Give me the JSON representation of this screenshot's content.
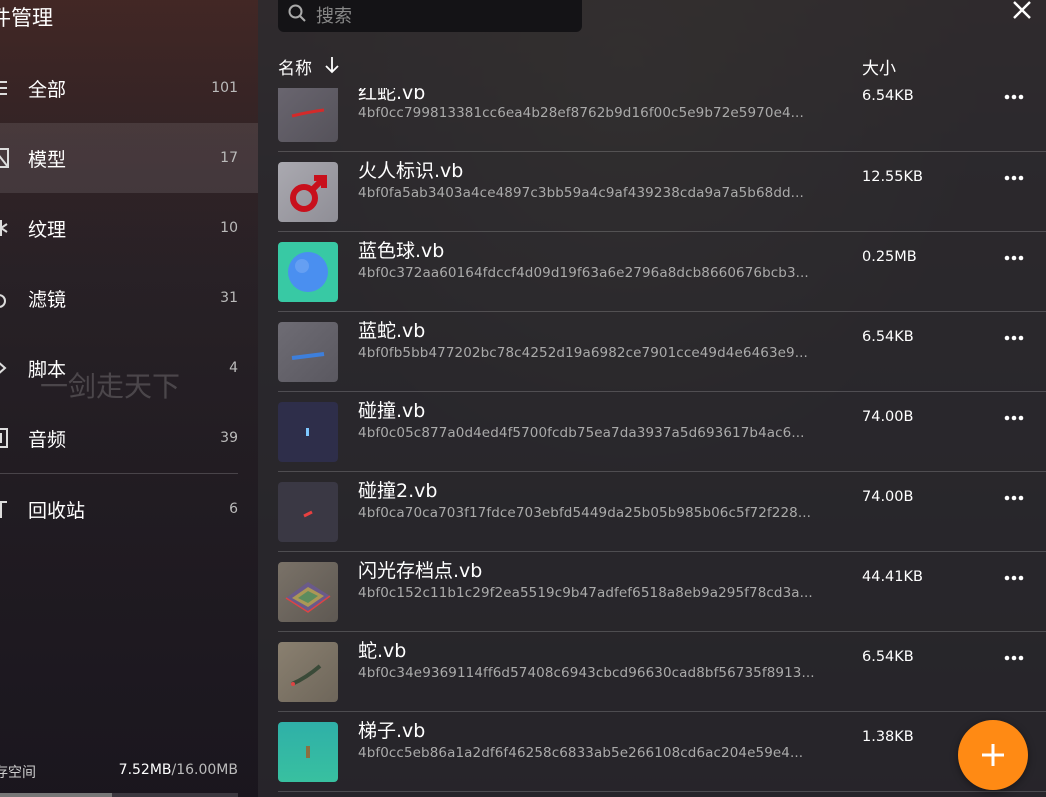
{
  "sidebar": {
    "title": "件管理",
    "items": [
      {
        "label": "全部",
        "count": "101",
        "icon": "layers-icon"
      },
      {
        "label": "模型",
        "count": "17",
        "icon": "cube-icon"
      },
      {
        "label": "纹理",
        "count": "10",
        "icon": "texture-icon"
      },
      {
        "label": "滤镜",
        "count": "31",
        "icon": "filter-icon"
      },
      {
        "label": "脚本",
        "count": "4",
        "icon": "code-icon"
      },
      {
        "label": "音频",
        "count": "39",
        "icon": "audio-icon"
      },
      {
        "label": "回收站",
        "count": "6",
        "icon": "trash-icon"
      }
    ],
    "watermark": "一剑走天下",
    "storage_label": "存空间",
    "storage_used": "7.52MB",
    "storage_total": "/16.00MB",
    "storage_fraction": 0.47
  },
  "main": {
    "search_placeholder": "搜索",
    "col_name": "名称",
    "col_size": "大小",
    "files": [
      {
        "name": "红蛇.vb",
        "hash": "4bf0cc799813381cc6ea4b28ef8762b9d16f00c5e9b72e5970e4...",
        "size": "6.54KB",
        "thumb": "red-snake"
      },
      {
        "name": "火人标识.vb",
        "hash": "4bf0fa5ab3403a4ce4897c3bb59a4c9af439238cda9a7a5b68dd...",
        "size": "12.55KB",
        "thumb": "male-symbol"
      },
      {
        "name": "蓝色球.vb",
        "hash": "4bf0c372aa60164fdccf4d09d19f63a6e2796a8dcb8660676bcb3...",
        "size": "0.25MB",
        "thumb": "blue-ball"
      },
      {
        "name": "蓝蛇.vb",
        "hash": "4bf0fb5bb477202bc78c4252d19a6982ce7901cce49d4e6463e9...",
        "size": "6.54KB",
        "thumb": "blue-snake"
      },
      {
        "name": "碰撞.vb",
        "hash": "4bf0c05c877a0d4ed4f5700fcdb75ea7da3937a5d693617b4ac6...",
        "size": "74.00B",
        "thumb": "collision-blue"
      },
      {
        "name": "碰撞2.vb",
        "hash": "4bf0ca70ca703f17fdce703ebfd5449da25b05b985b06c5f72f228...",
        "size": "74.00B",
        "thumb": "collision-red"
      },
      {
        "name": "闪光存档点.vb",
        "hash": "4bf0c152c11b1c29f2ea5519c9b47adfef6518a8eb9a295f78cd3a...",
        "size": "44.41KB",
        "thumb": "checkpoint"
      },
      {
        "name": "蛇.vb",
        "hash": "4bf0c34e9369114ff6d57408c6943cbcd96630cad8bf56735f8913...",
        "size": "6.54KB",
        "thumb": "snake"
      },
      {
        "name": "梯子.vb",
        "hash": "4bf0cc5eb86a1a2df6f46258c6833ab5e266108cd6ac204e59e4...",
        "size": "1.38KB",
        "thumb": "ladder"
      }
    ]
  },
  "colors": {
    "accent": "#ff8a14",
    "active_bg": "#3a3540"
  }
}
